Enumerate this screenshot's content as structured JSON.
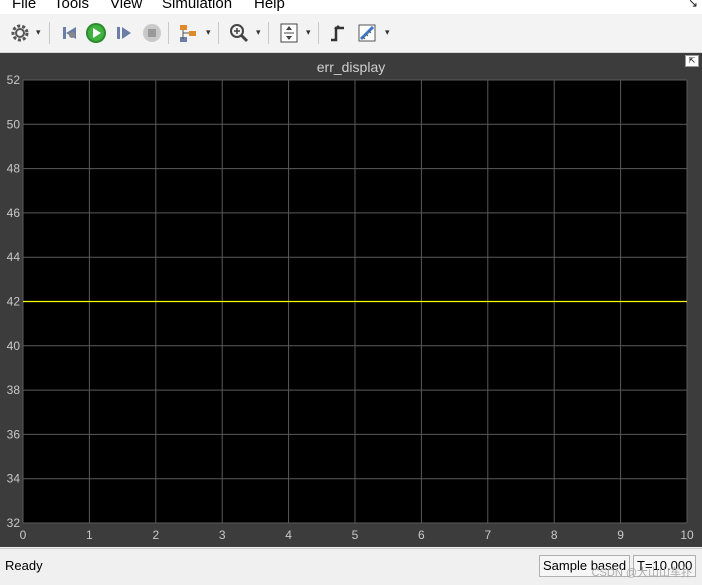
{
  "menu": [
    "File",
    "Tools",
    "View",
    "Simulation",
    "Help"
  ],
  "toolbar": {
    "icons": [
      "gear-icon",
      "step-back-icon",
      "run-icon",
      "step-forward-icon",
      "stop-icon",
      "signal-hierarchy-icon",
      "zoom-icon",
      "autoscale-icon",
      "trigger-icon",
      "measurements-icon"
    ]
  },
  "scope": {
    "title": "err_display",
    "undock_symbol": "⇱"
  },
  "chart_data": {
    "type": "line",
    "title": "err_display",
    "xlabel": "",
    "ylabel": "",
    "xlim": [
      0,
      10
    ],
    "ylim": [
      32,
      52
    ],
    "x_ticks": [
      "0",
      "1",
      "2",
      "3",
      "4",
      "5",
      "6",
      "7",
      "8",
      "9",
      "10"
    ],
    "y_ticks": [
      "32",
      "34",
      "36",
      "38",
      "40",
      "42",
      "44",
      "46",
      "48",
      "50",
      "52"
    ],
    "grid": true,
    "series": [
      {
        "x": [
          0,
          10
        ],
        "y": [
          42,
          42
        ],
        "color": "#ffff00"
      }
    ]
  },
  "status": {
    "left": "Ready",
    "sample": "Sample based",
    "time": "T=10.000",
    "watermark": "CSDN @大山山车扑"
  },
  "colors": {
    "plot_bg": "#000000",
    "frame_bg": "#3c3c3c",
    "grid": "#5a5a5a",
    "trace": "#ffff00",
    "tick": "#c8c8c8"
  }
}
